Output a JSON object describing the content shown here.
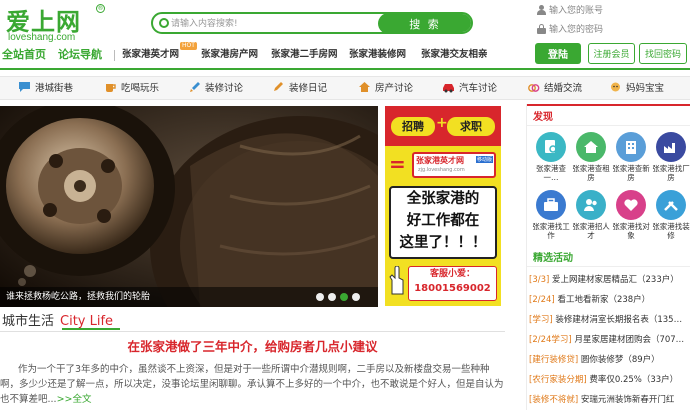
{
  "header": {
    "logo_text": "爱上网",
    "logo_sub": "loveshang.com",
    "logo_reg": "®",
    "search": {
      "placeholder": "请输入内容搜索!",
      "button_label": "搜 索"
    },
    "login": {
      "username_placeholder": "输入您的账号",
      "password_placeholder": "输入您的密码",
      "login_label": "登陆",
      "register_label": "注册会员",
      "forgot_label": "找回密码"
    },
    "nav": {
      "home": "全站首页",
      "forum_nav": "论坛导航",
      "hot_badge": "HOT",
      "links": [
        "张家港英才网",
        "张家港房产网",
        "张家港二手房网",
        "张家港装修网",
        "张家港交友相亲"
      ]
    }
  },
  "categories": [
    {
      "label": "港城街巷",
      "icon": "chat-bubble-icon"
    },
    {
      "label": "吃喝玩乐",
      "icon": "cup-icon"
    },
    {
      "label": "装修讨论",
      "icon": "brush-icon"
    },
    {
      "label": "装修日记",
      "icon": "pencil-icon"
    },
    {
      "label": "房产讨论",
      "icon": "house-icon"
    },
    {
      "label": "汽车讨论",
      "icon": "car-icon"
    },
    {
      "label": "结婚交流",
      "icon": "rings-icon"
    },
    {
      "label": "妈妈宝宝",
      "icon": "baby-icon"
    }
  ],
  "slider": {
    "caption": "谁来拯救杨屹公路，拯救我们的轮胎",
    "dots": 4,
    "active_dot": 2
  },
  "ad": {
    "tag1": "招聘",
    "plus": "+",
    "tag2": "求职",
    "eq": "=",
    "site_name": "张家港英才网",
    "site_url": "zjg.loveshang.com",
    "site_badge": "移动版",
    "main_lines": [
      "全张家港的",
      "好工作都在",
      "这里了！！！"
    ],
    "phone_label": "客服小爱：",
    "phone": "18001569002"
  },
  "city_life": {
    "title_cn": "城市生活",
    "title_en": "City Life",
    "headline": "在张家港做了三年中介，给购房者几点小建议",
    "body": "作为一个干了3年多的中介，虽然谈不上资深，但是对于一些所谓中介潜规则啊，二手房以及新楼盘交易一些种种啊，多少少还是了解一点，所以决定，没事论坛里闲聊聊。承认算不上多好的一个中介，也不敢说是个好人，但是自认为也不算差吧...",
    "more": ">>全文"
  },
  "sidebar": {
    "discover_title": "发现",
    "grid": [
      {
        "label": "张家港查一…",
        "icon": "search-doc-icon",
        "color": "#3bb8c4"
      },
      {
        "label": "张家港查租房",
        "icon": "house-icon",
        "color": "#4ab86a"
      },
      {
        "label": "张家港查新房",
        "icon": "building-icon",
        "color": "#5a9ed8"
      },
      {
        "label": "张家港找厂房",
        "icon": "factory-icon",
        "color": "#3a4aa0"
      },
      {
        "label": "张家港找工作",
        "icon": "briefcase-icon",
        "color": "#3a7ad0"
      },
      {
        "label": "张家港招人才",
        "icon": "people-icon",
        "color": "#3ab0c8"
      },
      {
        "label": "张家港找对象",
        "icon": "heart-icon",
        "color": "#d8408a"
      },
      {
        "label": "张家港找装修",
        "icon": "tools-icon",
        "color": "#3aa0d8"
      }
    ],
    "activities_title": "精选活动",
    "activities": [
      {
        "tag": "[3/3]",
        "text": "爱上网建材家居精品汇（233户）"
      },
      {
        "tag": "[2/24]",
        "text": "看工地看新家（238户）"
      },
      {
        "tag": "[学习]",
        "text": "装修建材涓室长期报名表（135…"
      },
      {
        "tag": "[2/24学习]",
        "text": "月星家居建材团购会（707…"
      },
      {
        "tag": "[建行装修贷]",
        "text": "圆你装修梦（89户）"
      },
      {
        "tag": "[农行家装分期]",
        "text": "费率仅0.25%（33户）"
      },
      {
        "tag": "[装修不将就]",
        "text": "安瑞元洲装饰新春开门红"
      }
    ]
  },
  "colors": {
    "brand_green": "#3aa832",
    "accent_red": "#d8262c",
    "ad_yellow": "#f2e022"
  }
}
